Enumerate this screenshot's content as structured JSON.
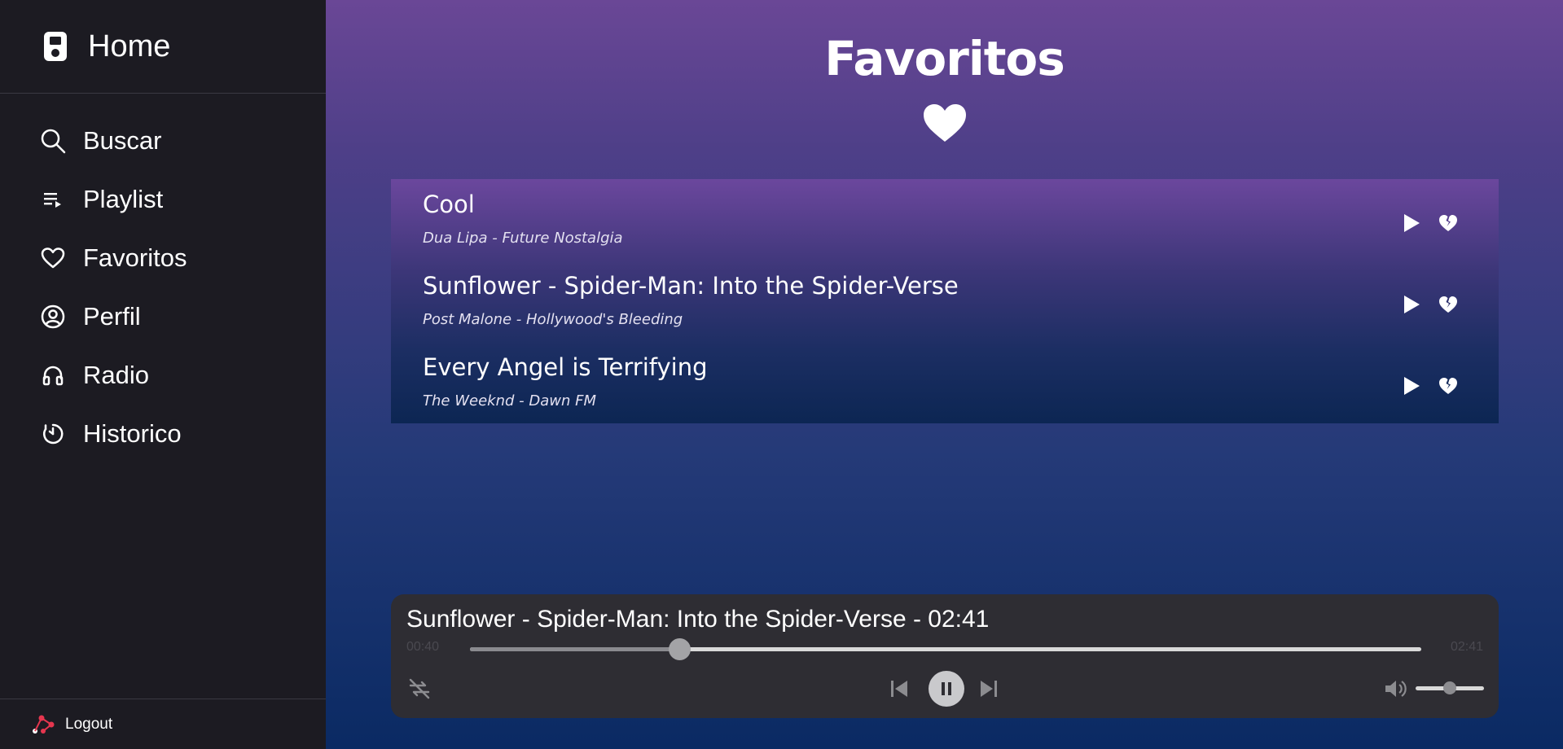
{
  "sidebar": {
    "home_label": "Home",
    "items": [
      {
        "label": "Buscar",
        "icon": "search-icon"
      },
      {
        "label": "Playlist",
        "icon": "playlist-icon"
      },
      {
        "label": "Favoritos",
        "icon": "heart-outline-icon"
      },
      {
        "label": "Perfil",
        "icon": "user-circle-icon"
      },
      {
        "label": "Radio",
        "icon": "headphones-icon"
      },
      {
        "label": "Historico",
        "icon": "history-icon"
      }
    ],
    "logout_label": "Logout"
  },
  "main": {
    "title": "Favoritos",
    "favorites": [
      {
        "title": "Cool",
        "subtitle": "Dua Lipa - Future Nostalgia"
      },
      {
        "title": "Sunflower - Spider-Man: Into the Spider-Verse",
        "subtitle": "Post Malone - Hollywood's Bleeding"
      },
      {
        "title": "Every Angel is Terrifying",
        "subtitle": "The Weeknd - Dawn FM"
      }
    ]
  },
  "player": {
    "now_playing": "Sunflower - Spider-Man: Into the Spider-Verse - 02:41",
    "current_time": "00:40",
    "total_time": "02:41",
    "progress": 0.22,
    "volume": 0.5
  },
  "colors": {
    "sidebar_bg": "#1c1b22",
    "gradient_top": "#6a4796",
    "gradient_bottom": "#0a2a63",
    "player_bg": "#2e2d33"
  }
}
